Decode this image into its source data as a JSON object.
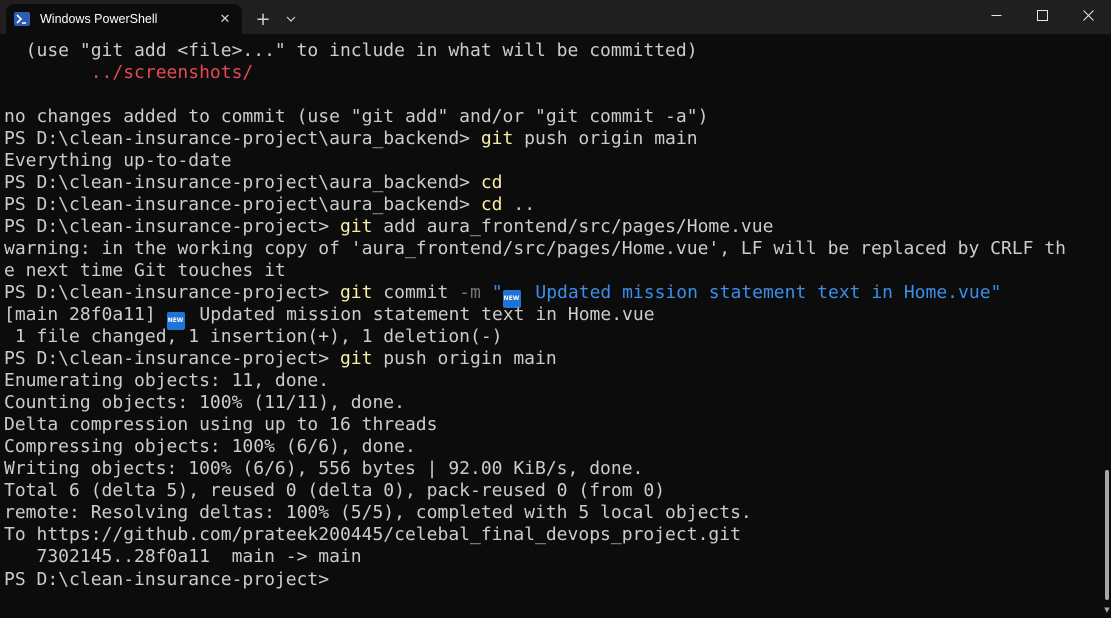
{
  "window": {
    "tab_title": "Windows PowerShell",
    "tab_icon": "powershell-icon",
    "close_tab_glyph": "✕",
    "new_tab_glyph": "+",
    "dropdown_glyph": "⌄",
    "minimize_glyph": "─",
    "maximize_glyph": "☐",
    "close_glyph": "✕"
  },
  "terminal": {
    "colors": {
      "background": "#0c0c0c",
      "text": "#cccccc",
      "command": "#f9f1a5",
      "error": "#e74856",
      "string": "#3b8eea"
    },
    "lines": [
      {
        "segments": [
          {
            "text": "  (use \"git add <file>...\" to include in what will be committed)"
          }
        ]
      },
      {
        "segments": [
          {
            "text": "        "
          },
          {
            "text": "../screenshots/",
            "style": "red"
          }
        ]
      },
      {
        "segments": [
          {
            "text": ""
          }
        ]
      },
      {
        "segments": [
          {
            "text": "no changes added to commit (use \"git add\" and/or \"git commit -a\")"
          }
        ]
      },
      {
        "segments": [
          {
            "text": "PS D:\\clean-insurance-project\\aura_backend> "
          },
          {
            "text": "git",
            "style": "cmd"
          },
          {
            "text": " push origin main"
          }
        ]
      },
      {
        "segments": [
          {
            "text": "Everything up-to-date"
          }
        ]
      },
      {
        "segments": [
          {
            "text": "PS D:\\clean-insurance-project\\aura_backend> "
          },
          {
            "text": "cd",
            "style": "cmd"
          }
        ]
      },
      {
        "segments": [
          {
            "text": "PS D:\\clean-insurance-project\\aura_backend> "
          },
          {
            "text": "cd",
            "style": "cmd"
          },
          {
            "text": " .."
          }
        ]
      },
      {
        "segments": [
          {
            "text": "PS D:\\clean-insurance-project> "
          },
          {
            "text": "git",
            "style": "cmd"
          },
          {
            "text": " add aura_frontend/src/pages/Home.vue"
          }
        ]
      },
      {
        "segments": [
          {
            "text": "warning: in the working copy of 'aura_frontend/src/pages/Home.vue', LF will be replaced by CRLF th"
          }
        ]
      },
      {
        "segments": [
          {
            "text": "e next time Git touches it"
          }
        ]
      },
      {
        "segments": [
          {
            "text": "PS D:\\clean-insurance-project> "
          },
          {
            "text": "git",
            "style": "cmd"
          },
          {
            "text": " commit "
          },
          {
            "text": "-m",
            "style": "flag"
          },
          {
            "text": " \"",
            "style": "str"
          },
          {
            "badge": "NEW"
          },
          {
            "text": " Updated mission statement text in Home.vue\"",
            "style": "str"
          }
        ]
      },
      {
        "segments": [
          {
            "text": "[main 28f0a11] "
          },
          {
            "badge": "NEW"
          },
          {
            "text": " Updated mission statement text in Home.vue"
          }
        ]
      },
      {
        "segments": [
          {
            "text": " 1 file changed, 1 insertion(+), 1 deletion(-)"
          }
        ]
      },
      {
        "segments": [
          {
            "text": "PS D:\\clean-insurance-project> "
          },
          {
            "text": "git",
            "style": "cmd"
          },
          {
            "text": " push origin main"
          }
        ]
      },
      {
        "segments": [
          {
            "text": "Enumerating objects: 11, done."
          }
        ]
      },
      {
        "segments": [
          {
            "text": "Counting objects: 100% (11/11), done."
          }
        ]
      },
      {
        "segments": [
          {
            "text": "Delta compression using up to 16 threads"
          }
        ]
      },
      {
        "segments": [
          {
            "text": "Compressing objects: 100% (6/6), done."
          }
        ]
      },
      {
        "segments": [
          {
            "text": "Writing objects: 100% (6/6), 556 bytes | 92.00 KiB/s, done."
          }
        ]
      },
      {
        "segments": [
          {
            "text": "Total 6 (delta 5), reused 0 (delta 0), pack-reused 0 (from 0)"
          }
        ]
      },
      {
        "segments": [
          {
            "text": "remote: Resolving deltas: 100% (5/5), completed with 5 local objects."
          }
        ]
      },
      {
        "segments": [
          {
            "text": "To https://github.com/prateek200445/celebal_final_devops_project.git"
          }
        ]
      },
      {
        "segments": [
          {
            "text": "   7302145..28f0a11  main -> main"
          }
        ]
      },
      {
        "segments": [
          {
            "text": "PS D:\\clean-insurance-project> "
          }
        ],
        "cursor": true
      }
    ]
  }
}
